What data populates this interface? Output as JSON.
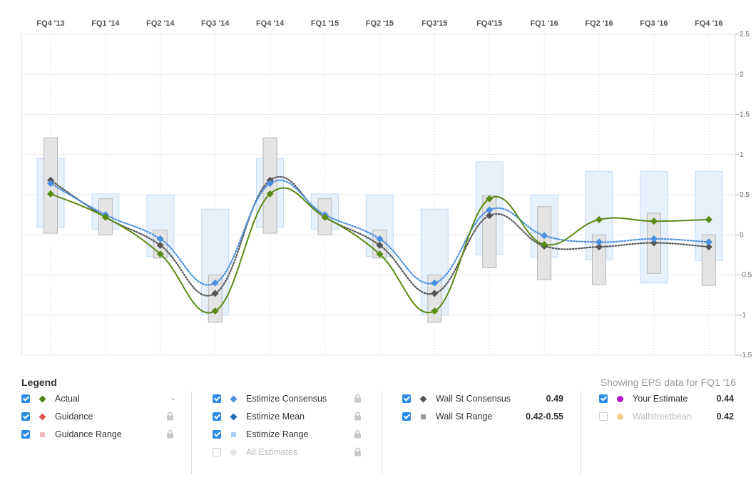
{
  "chart_data": {
    "type": "line",
    "quarters": [
      "FQ4 '13",
      "FQ1 '14",
      "FQ2 '14",
      "FQ3 '14",
      "FQ4 '14",
      "FQ1 '15",
      "FQ2 '15",
      "FQ3'15",
      "FQ4'15",
      "FQ1 '16",
      "FQ2 '16",
      "FQ3 '16",
      "FQ4 '16"
    ],
    "y_ticks": [
      "2.5",
      "2",
      "1.5",
      "1",
      "0.5",
      "0",
      "-0.5",
      "-1",
      "-1.5"
    ],
    "ylim": [
      -1.5,
      2.5
    ],
    "grid": true,
    "series": [
      {
        "name": "Actual",
        "color": "#5a8a12",
        "style": "solid",
        "points": [
          [
            0,
            0.51
          ],
          [
            1,
            0.22
          ],
          [
            2,
            -0.24
          ],
          [
            3,
            -0.95
          ],
          [
            4,
            0.51
          ],
          [
            5,
            0.22
          ],
          [
            6,
            -0.24
          ],
          [
            7,
            -0.95
          ],
          [
            8,
            0.45
          ],
          [
            9,
            -0.12
          ],
          [
            10,
            0.19
          ],
          [
            11,
            0.17
          ],
          [
            12,
            0.19
          ]
        ]
      },
      {
        "name": "Wall St Consensus",
        "color": "#555555",
        "style": "dotted",
        "points": [
          [
            0,
            0.68
          ],
          [
            1,
            0.22
          ],
          [
            2,
            -0.13
          ],
          [
            3,
            -0.73
          ],
          [
            4,
            0.68
          ],
          [
            5,
            0.22
          ],
          [
            6,
            -0.13
          ],
          [
            7,
            -0.73
          ],
          [
            8,
            0.24
          ],
          [
            9,
            -0.14
          ],
          [
            10,
            -0.15
          ],
          [
            11,
            -0.1
          ],
          [
            12,
            -0.15
          ]
        ]
      },
      {
        "name": "Estimize Consensus",
        "color": "#4a90e2",
        "style": "dotted",
        "points": [
          [
            0,
            0.64
          ],
          [
            1,
            0.25
          ],
          [
            2,
            -0.05
          ],
          [
            3,
            -0.6
          ],
          [
            4,
            0.64
          ],
          [
            5,
            0.25
          ],
          [
            6,
            -0.05
          ],
          [
            7,
            -0.6
          ],
          [
            8,
            0.31
          ],
          [
            9,
            -0.01
          ],
          [
            10,
            -0.09
          ],
          [
            11,
            -0.05
          ],
          [
            12,
            -0.09
          ]
        ]
      }
    ],
    "estimize_range": [
      [
        0,
        0.95,
        0.09
      ],
      [
        1,
        0.51,
        0.07
      ],
      [
        2,
        0.5,
        -0.27
      ],
      [
        3,
        0.32,
        -1.0
      ],
      [
        4,
        0.95,
        0.09
      ],
      [
        5,
        0.51,
        0.07
      ],
      [
        6,
        0.5,
        -0.27
      ],
      [
        7,
        0.32,
        -1.0
      ],
      [
        8,
        0.91,
        -0.25
      ],
      [
        9,
        0.5,
        -0.28
      ],
      [
        10,
        0.79,
        -0.31
      ],
      [
        11,
        0.79,
        -0.6
      ],
      [
        12,
        0.79,
        -0.32
      ]
    ],
    "wallst_range": [
      [
        0,
        1.21,
        0.02
      ],
      [
        1,
        0.45,
        0.0
      ],
      [
        2,
        0.06,
        -0.29
      ],
      [
        3,
        -0.5,
        -1.09
      ],
      [
        4,
        1.21,
        0.02
      ],
      [
        5,
        0.45,
        0.0
      ],
      [
        6,
        0.06,
        -0.29
      ],
      [
        7,
        -0.5,
        -1.09
      ],
      [
        8,
        0.49,
        -0.41
      ],
      [
        9,
        0.35,
        -0.56
      ],
      [
        10,
        0.0,
        -0.62
      ],
      [
        11,
        0.27,
        -0.48
      ],
      [
        12,
        0.0,
        -0.63
      ]
    ]
  },
  "legend": {
    "title": "Legend",
    "showing": "Showing EPS data for FQ1 '16",
    "col1": [
      {
        "label": "Actual",
        "value": "-",
        "checked": true,
        "symbol": "diamond",
        "color": "#4f7f12"
      },
      {
        "label": "Guidance",
        "checked": true,
        "symbol": "diamond",
        "color": "#e05656",
        "locked": true
      },
      {
        "label": "Guidance Range",
        "checked": true,
        "symbol": "square",
        "color": "#f4b8c0",
        "locked": true
      }
    ],
    "col2": [
      {
        "label": "Estimize Consensus",
        "checked": true,
        "symbol": "diamond",
        "color": "#4a90e2",
        "locked": true
      },
      {
        "label": "Estimize Mean",
        "checked": true,
        "symbol": "diamond",
        "color": "#1a6bb8",
        "locked": true
      },
      {
        "label": "Estimize Range",
        "checked": true,
        "symbol": "square",
        "color": "#a9cff2",
        "locked": true
      },
      {
        "label": "All Estimates",
        "checked": false,
        "symbol": "dot",
        "color": "#e6e6e6",
        "locked": true
      }
    ],
    "col3": [
      {
        "label": "Wall St Consensus",
        "value": "0.49",
        "checked": true,
        "symbol": "diamond",
        "color": "#555555"
      },
      {
        "label": "Wall St Range",
        "value": "0.42-0.55",
        "checked": true,
        "symbol": "square",
        "color": "#999999"
      }
    ],
    "col4": [
      {
        "label": "Your Estimate",
        "value": "0.44",
        "checked": true,
        "symbol": "dot",
        "color": "#b316c9"
      },
      {
        "label": "Wallstreetbean",
        "value": "0.42",
        "checked": false,
        "symbol": "dot",
        "color": "#f8cf8a"
      }
    ]
  }
}
